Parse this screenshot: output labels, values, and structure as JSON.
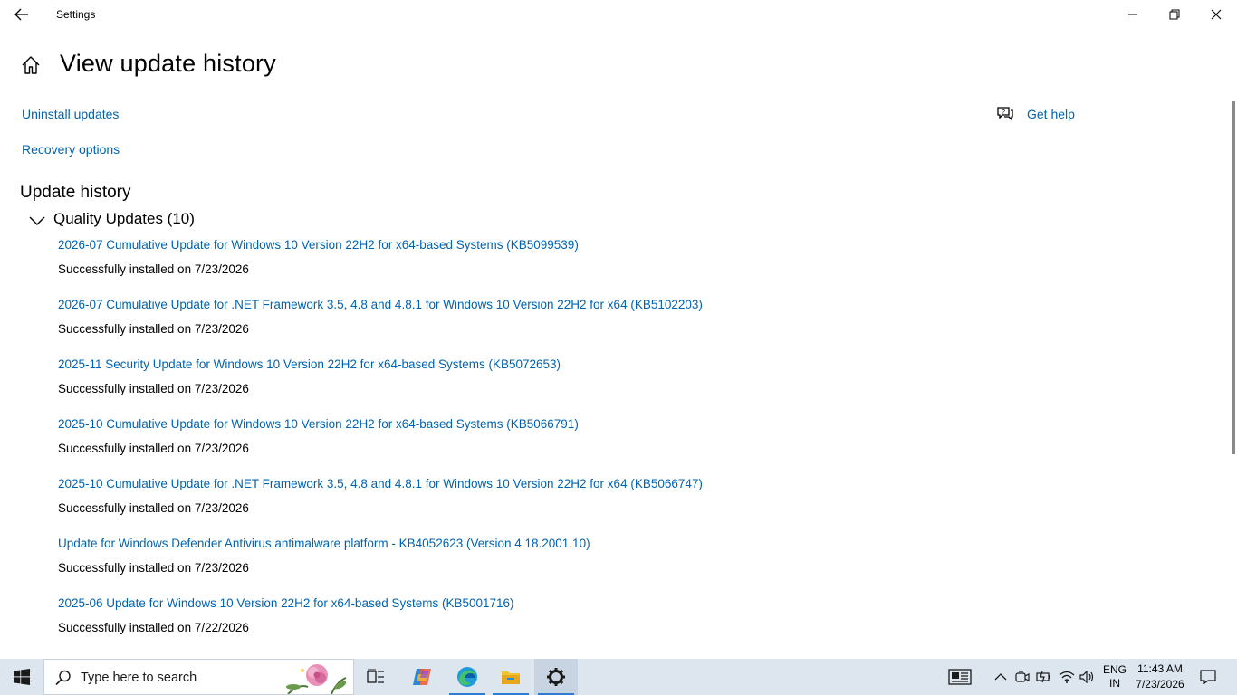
{
  "window": {
    "title": "Settings"
  },
  "page": {
    "title": "View update history"
  },
  "links": {
    "uninstall": "Uninstall updates",
    "recovery": "Recovery options",
    "help": "Get help"
  },
  "history": {
    "title": "Update history",
    "group_title": "Quality Updates (10)",
    "items": [
      {
        "name": "2026-07 Cumulative Update for Windows 10 Version 22H2 for x64-based Systems (KB5099539)",
        "status": "Successfully installed on 7/23/2026"
      },
      {
        "name": "2026-07 Cumulative Update for .NET Framework 3.5, 4.8 and 4.8.1 for Windows 10 Version 22H2 for x64 (KB5102203)",
        "status": "Successfully installed on 7/23/2026"
      },
      {
        "name": "2025-11 Security Update for Windows 10 Version 22H2 for x64-based Systems (KB5072653)",
        "status": "Successfully installed on 7/23/2026"
      },
      {
        "name": "2025-10 Cumulative Update for Windows 10 Version 22H2 for x64-based Systems (KB5066791)",
        "status": "Successfully installed on 7/23/2026"
      },
      {
        "name": "2025-10 Cumulative Update for .NET Framework 3.5, 4.8 and 4.8.1 for Windows 10 Version 22H2 for x64 (KB5066747)",
        "status": "Successfully installed on 7/23/2026"
      },
      {
        "name": "Update for Windows Defender Antivirus antimalware platform - KB4052623 (Version 4.18.2001.10)",
        "status": "Successfully installed on 7/23/2026"
      },
      {
        "name": "2025-06 Update for Windows 10 Version 22H2 for x64-based Systems (KB5001716)",
        "status": "Successfully installed on 7/22/2026"
      }
    ]
  },
  "taskbar": {
    "search_placeholder": "Type here to search",
    "lang_top": "ENG",
    "lang_bottom": "IN",
    "time": "11:43 AM",
    "date": "7/23/2026",
    "icons": [
      "windows-icon",
      "search-icon",
      "task-view-icon",
      "copilot-icon",
      "edge-icon",
      "file-explorer-icon",
      "settings-icon",
      "news-icon",
      "chevron-up-icon",
      "meet-icon",
      "battery-icon",
      "wifi-icon",
      "volume-icon",
      "notification-icon"
    ]
  },
  "colors": {
    "link": "#0063b1",
    "taskbar": "#dde6ef",
    "accent": "#2d7dd2"
  }
}
